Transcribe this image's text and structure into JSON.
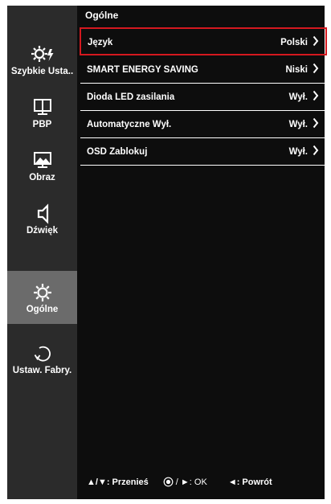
{
  "sidebar": {
    "items": [
      {
        "label": "Szybkie Usta..",
        "icon": "quick-settings-icon",
        "active": false
      },
      {
        "label": "PBP",
        "icon": "pbp-icon",
        "active": false
      },
      {
        "label": "Obraz",
        "icon": "picture-icon",
        "active": false
      },
      {
        "label": "Dźwięk",
        "icon": "speaker-icon",
        "active": false
      },
      {
        "label": "Ogólne",
        "icon": "gear-icon",
        "active": true
      },
      {
        "label": "Ustaw. Fabry.",
        "icon": "reset-icon",
        "active": false
      }
    ]
  },
  "main": {
    "title": "Ogólne",
    "rows": [
      {
        "name": "Język",
        "value": "Polski",
        "selected": true
      },
      {
        "name": "SMART ENERGY SAVING",
        "value": "Niski",
        "selected": false
      },
      {
        "name": "Dioda LED zasilania",
        "value": "Wył.",
        "selected": false
      },
      {
        "name": "Automatyczne Wył.",
        "value": "Wył.",
        "selected": false
      },
      {
        "name": "OSD Zablokuj",
        "value": "Wył.",
        "selected": false
      }
    ]
  },
  "footer": {
    "move": "▲/▼: Przenieś",
    "ok": "/ ►: OK",
    "back": "◄: Powrót"
  },
  "colors": {
    "selection_border": "#d4181f",
    "active_tab": "#6b6b6b",
    "sidebar_bg": "#2b2b2b",
    "panel_bg": "#0d0d0d"
  }
}
